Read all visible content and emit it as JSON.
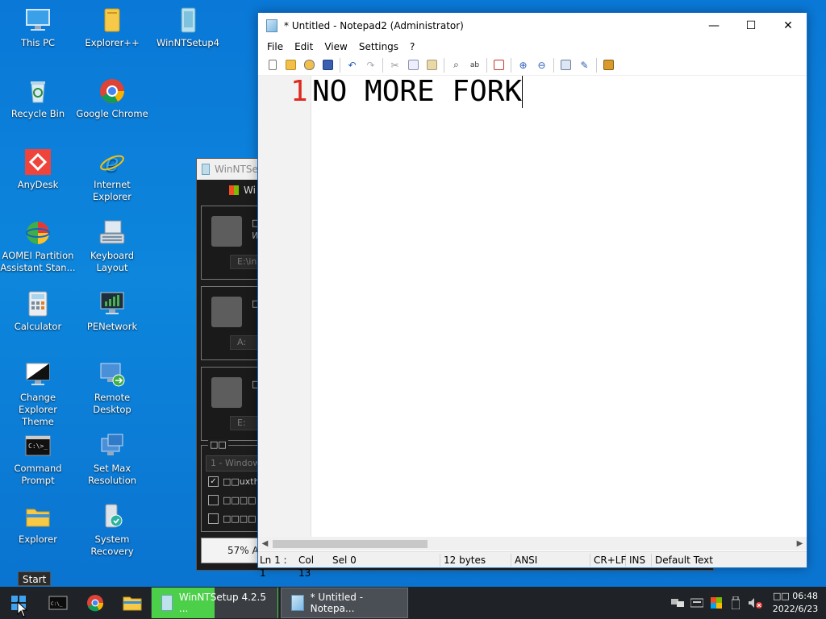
{
  "desktop": {
    "icons": [
      {
        "label": "This PC"
      },
      {
        "label": "Explorer++"
      },
      {
        "label": "WinNTSetup4"
      },
      {
        "label": "Recycle Bin"
      },
      {
        "label": "Google Chrome"
      },
      {
        "label": "AnyDesk"
      },
      {
        "label": "Internet Explorer"
      },
      {
        "label": "AOMEI Partition\nAssistant Stan..."
      },
      {
        "label": "Keyboard Layout"
      },
      {
        "label": "Calculator"
      },
      {
        "label": "PENetwork"
      },
      {
        "label": "Change Explorer\nTheme"
      },
      {
        "label": "Remote Desktop"
      },
      {
        "label": "Command\nPrompt"
      },
      {
        "label": "Set Max\nResolution"
      },
      {
        "label": "Explorer"
      },
      {
        "label": "System Recovery"
      }
    ]
  },
  "winntsetup": {
    "title": "WinNTSet",
    "subtitle": "Wi",
    "panels": [
      {
        "text": "□□",
        "sub": "W",
        "path": "E:\\in"
      },
      {
        "text": "□□",
        "sub": "",
        "path": "A:"
      },
      {
        "text": "□□",
        "sub": "",
        "path": "E:"
      }
    ],
    "options_label": "□□",
    "edition": "1 - Window",
    "checks": [
      "□□uxthe",
      "□□□□",
      "□□□□"
    ],
    "progress_text": "57% Ap"
  },
  "notepad": {
    "title": "* Untitled - Notepad2 (Administrator)",
    "window_buttons": {
      "minimize": "—",
      "maximize": "☐",
      "close": "✕"
    },
    "menu": [
      "File",
      "Edit",
      "View",
      "Settings",
      "?"
    ],
    "line_number": "1",
    "text": "NO MORE FORK",
    "status": {
      "position": "Ln 1 : 1",
      "col": "Col 13",
      "sel": "Sel 0",
      "bytes": "12 bytes",
      "encoding": "ANSI",
      "eol": "CR+LF",
      "mode": "INS",
      "scheme": "Default Text"
    }
  },
  "tooltip": "Start",
  "taskbar": {
    "tasks": [
      {
        "label": "WinNTSetup 4.2.5  ..."
      },
      {
        "label": "* Untitled - Notepa..."
      }
    ],
    "clock_time": "□□ 06:48",
    "clock_date": "2022/6/23"
  },
  "colors": {
    "desktop": "#0a78d7",
    "taskbar": "#1f2226",
    "line_number": "#e0281f",
    "winnt_task": "#4cd04a"
  }
}
